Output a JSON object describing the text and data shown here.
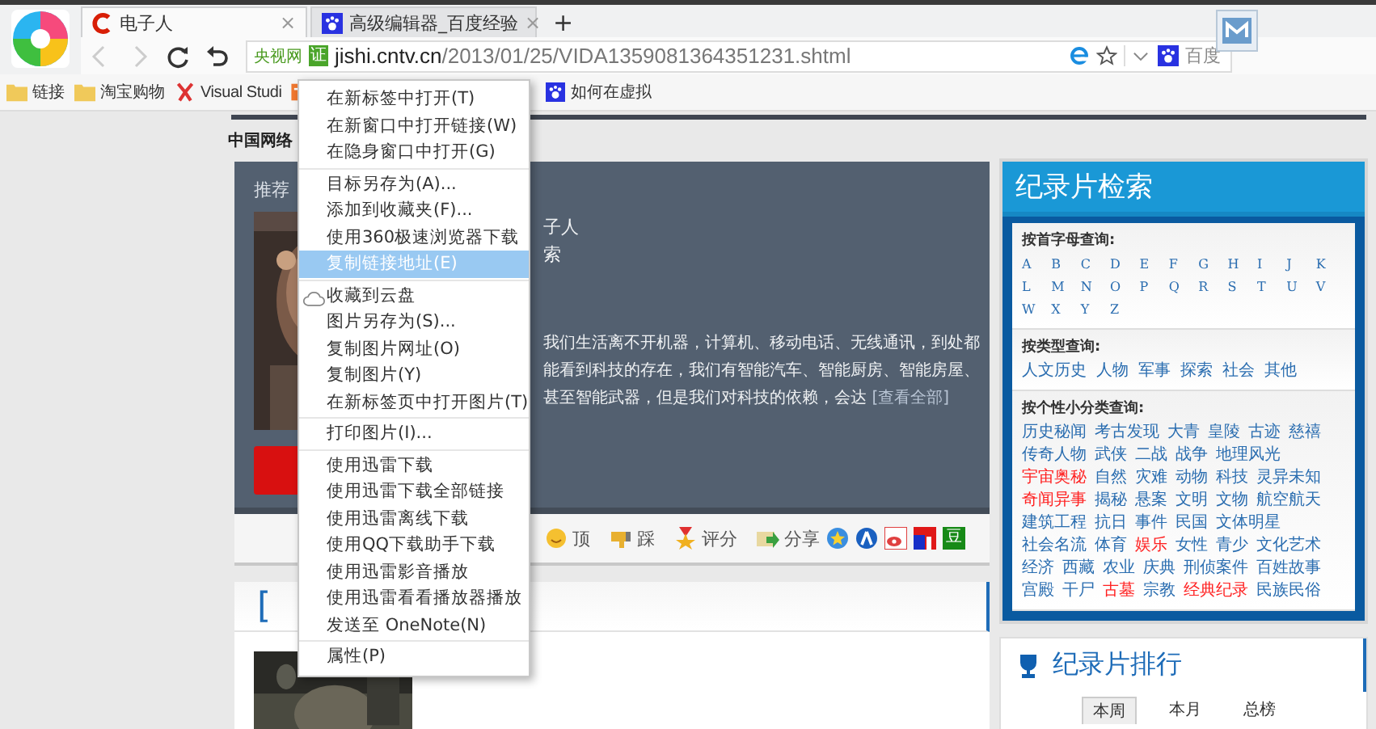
{
  "browser": {
    "tabs": [
      {
        "title": "电子人",
        "kind": "cntv",
        "selected": true,
        "close": "×"
      },
      {
        "title": "高级编辑器_百度经验",
        "kind": "paw",
        "selected": false,
        "close": "×"
      }
    ],
    "new_tab": "+",
    "address": {
      "site_label": "央视网",
      "badge": "证",
      "host": "jishi.cntv.cn",
      "path": "/2013/01/25/VIDA1359081364351231.shtml"
    },
    "search_engine": "百度"
  },
  "bookmarks": [
    {
      "label": "链接",
      "kind": "folder"
    },
    {
      "label": "淘宝购物",
      "kind": "folder"
    },
    {
      "label": "Visual Studi",
      "kind": "vs"
    },
    {
      "kind": "page"
    },
    {
      "label": "如何在虚拟",
      "kind": "paw"
    }
  ],
  "page": {
    "site_heading": "中国网络",
    "feature": {
      "recommend_label": "推荐",
      "meta": [
        "子人",
        "索"
      ],
      "summary": "我们生活离不开机器，计算机、移动电话、无线通讯，到处都能看到科技的存在，我们有智能汽车、智能厨房、智能房屋、甚至智能武器，但是我们对科技的依赖，会达",
      "more_link": "[查看全部]"
    },
    "actions": [
      {
        "label": "顶",
        "kind": "smile"
      },
      {
        "label": "踩",
        "kind": "thumb"
      },
      {
        "label": "评分",
        "kind": "medal"
      },
      {
        "label": "分享",
        "kind": "share"
      }
    ],
    "share_icons": [
      {
        "kind": "star"
      },
      {
        "kind": "person"
      },
      {
        "kind": "weibo"
      },
      {
        "kind": "flag"
      },
      {
        "kind": "douban",
        "label": "豆"
      }
    ],
    "section_title": "["
  },
  "search_panel": {
    "title": "纪录片检索",
    "letters_heading": "按首字母查询:",
    "letters": [
      "A",
      "B",
      "C",
      "D",
      "E",
      "F",
      "G",
      "H",
      "I",
      "J",
      "K",
      "L",
      "M",
      "N",
      "O",
      "P",
      "Q",
      "R",
      "S",
      "T",
      "U",
      "V",
      "W",
      "X",
      "Y",
      "Z"
    ],
    "type_heading": "按类型查询:",
    "types": [
      "人文历史",
      "人物",
      "军事",
      "探索",
      "社会",
      "其他"
    ],
    "tag_heading": "按个性小分类查询:",
    "tags": [
      {
        "label": "历史秘闻",
        "color": "#2a6db0"
      },
      {
        "label": "考古发现",
        "color": "#2a6db0"
      },
      {
        "label": "大青",
        "color": "#2a6db0"
      },
      {
        "label": "皇陵",
        "color": "#2a6db0"
      },
      {
        "label": "古迹",
        "color": "#2a6db0"
      },
      {
        "label": "慈禧",
        "color": "#2a6db0"
      },
      {
        "label": "传奇人物",
        "color": "#2a6db0"
      },
      {
        "label": "武侠",
        "color": "#2a6db0"
      },
      {
        "label": "二战",
        "color": "#2a6db0"
      },
      {
        "label": "战争",
        "color": "#2a6db0"
      },
      {
        "label": "地理风光",
        "color": "#2a6db0"
      },
      {
        "label": "宇宙奥秘",
        "color": "#ff2020"
      },
      {
        "label": "自然",
        "color": "#2a6db0"
      },
      {
        "label": "灾难",
        "color": "#2a6db0"
      },
      {
        "label": "动物",
        "color": "#2a6db0"
      },
      {
        "label": "科技",
        "color": "#2a6db0"
      },
      {
        "label": "灵异未知",
        "color": "#2a6db0"
      },
      {
        "label": "奇闻异事",
        "color": "#ff2020"
      },
      {
        "label": "揭秘",
        "color": "#2a6db0"
      },
      {
        "label": "悬案",
        "color": "#2a6db0"
      },
      {
        "label": "文明",
        "color": "#2a6db0"
      },
      {
        "label": "文物",
        "color": "#2a6db0"
      },
      {
        "label": "航空航天",
        "color": "#2a6db0"
      },
      {
        "label": "建筑工程",
        "color": "#2a6db0"
      },
      {
        "label": "抗日",
        "color": "#2a6db0"
      },
      {
        "label": "事件",
        "color": "#2a6db0"
      },
      {
        "label": "民国",
        "color": "#2a6db0"
      },
      {
        "label": "文体明星",
        "color": "#2a6db0"
      },
      {
        "label": "社会名流",
        "color": "#2a6db0"
      },
      {
        "label": "体育",
        "color": "#2a6db0"
      },
      {
        "label": "娱乐",
        "color": "#ff2020"
      },
      {
        "label": "女性",
        "color": "#2a6db0"
      },
      {
        "label": "青少",
        "color": "#2a6db0"
      },
      {
        "label": "文化艺术",
        "color": "#2a6db0"
      },
      {
        "label": "经济",
        "color": "#2a6db0"
      },
      {
        "label": "西藏",
        "color": "#2a6db0"
      },
      {
        "label": "农业",
        "color": "#2a6db0"
      },
      {
        "label": "庆典",
        "color": "#2a6db0"
      },
      {
        "label": "刑侦案件",
        "color": "#2a6db0"
      },
      {
        "label": "百姓故事",
        "color": "#2a6db0"
      },
      {
        "label": "宫殿",
        "color": "#2a6db0"
      },
      {
        "label": "干尸",
        "color": "#2a6db0"
      },
      {
        "label": "古墓",
        "color": "#ff2020"
      },
      {
        "label": "宗教",
        "color": "#2a6db0"
      },
      {
        "label": "经典纪录",
        "color": "#ff2020"
      },
      {
        "label": "民族民俗",
        "color": "#2a6db0"
      }
    ]
  },
  "ranking": {
    "title": "纪录片排行",
    "tabs": [
      {
        "label": "本周",
        "selected": true
      },
      {
        "label": "本月",
        "selected": false
      },
      {
        "label": "总榜",
        "selected": false
      }
    ]
  },
  "context_menu": {
    "groups": [
      [
        {
          "label": "在新标签中打开(T)",
          "selected": false
        },
        {
          "label": "在新窗口中打开链接(W)",
          "selected": false
        },
        {
          "label": "在隐身窗口中打开(G)",
          "selected": false
        }
      ],
      [
        {
          "label": "目标另存为(A)...",
          "selected": false
        },
        {
          "label": "添加到收藏夹(F)...",
          "selected": false
        },
        {
          "label": "使用360极速浏览器下载",
          "selected": false
        },
        {
          "label": "复制链接地址(E)",
          "selected": true
        }
      ],
      [
        {
          "label": "收藏到云盘",
          "selected": false,
          "kind": "cloud"
        },
        {
          "label": "图片另存为(S)...",
          "selected": false
        },
        {
          "label": "复制图片网址(O)",
          "selected": false
        },
        {
          "label": "复制图片(Y)",
          "selected": false
        },
        {
          "label": "在新标签页中打开图片(T)",
          "selected": false
        }
      ],
      [
        {
          "label": "打印图片(I)...",
          "selected": false
        }
      ],
      [
        {
          "label": "使用迅雷下载",
          "selected": false
        },
        {
          "label": "使用迅雷下载全部链接",
          "selected": false
        },
        {
          "label": "使用迅雷离线下载",
          "selected": false
        },
        {
          "label": "使用QQ下载助手下载",
          "selected": false
        },
        {
          "label": "使用迅雷影音播放",
          "selected": false
        },
        {
          "label": "使用迅雷看看播放器播放",
          "selected": false
        },
        {
          "label": "发送至 OneNote(N)",
          "selected": false
        }
      ],
      [
        {
          "label": "属性(P)",
          "selected": false
        }
      ]
    ]
  }
}
